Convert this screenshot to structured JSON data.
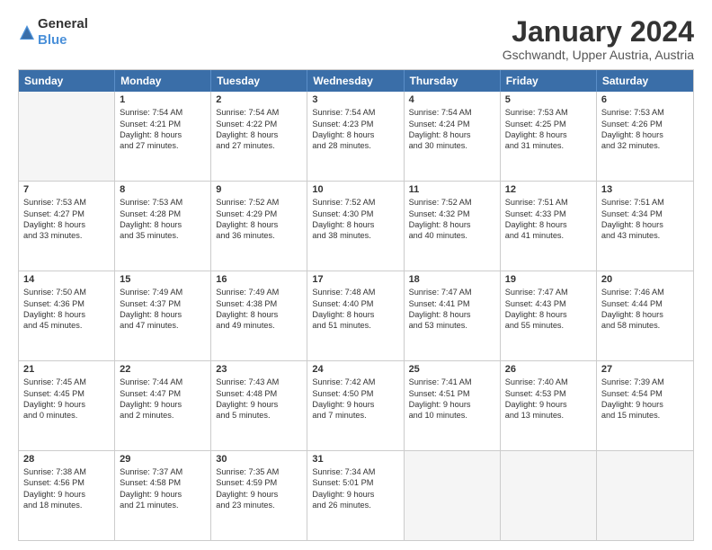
{
  "header": {
    "logo_general": "General",
    "logo_blue": "Blue",
    "title": "January 2024",
    "subtitle": "Gschwandt, Upper Austria, Austria"
  },
  "days": [
    "Sunday",
    "Monday",
    "Tuesday",
    "Wednesday",
    "Thursday",
    "Friday",
    "Saturday"
  ],
  "weeks": [
    [
      {
        "day": "",
        "sunrise": "",
        "sunset": "",
        "daylight": "",
        "empty": true
      },
      {
        "day": "1",
        "sunrise": "Sunrise: 7:54 AM",
        "sunset": "Sunset: 4:21 PM",
        "daylight": "Daylight: 8 hours and 27 minutes."
      },
      {
        "day": "2",
        "sunrise": "Sunrise: 7:54 AM",
        "sunset": "Sunset: 4:22 PM",
        "daylight": "Daylight: 8 hours and 27 minutes."
      },
      {
        "day": "3",
        "sunrise": "Sunrise: 7:54 AM",
        "sunset": "Sunset: 4:23 PM",
        "daylight": "Daylight: 8 hours and 28 minutes."
      },
      {
        "day": "4",
        "sunrise": "Sunrise: 7:54 AM",
        "sunset": "Sunset: 4:24 PM",
        "daylight": "Daylight: 8 hours and 30 minutes."
      },
      {
        "day": "5",
        "sunrise": "Sunrise: 7:53 AM",
        "sunset": "Sunset: 4:25 PM",
        "daylight": "Daylight: 8 hours and 31 minutes."
      },
      {
        "day": "6",
        "sunrise": "Sunrise: 7:53 AM",
        "sunset": "Sunset: 4:26 PM",
        "daylight": "Daylight: 8 hours and 32 minutes."
      }
    ],
    [
      {
        "day": "7",
        "sunrise": "Sunrise: 7:53 AM",
        "sunset": "Sunset: 4:27 PM",
        "daylight": "Daylight: 8 hours and 33 minutes."
      },
      {
        "day": "8",
        "sunrise": "Sunrise: 7:53 AM",
        "sunset": "Sunset: 4:28 PM",
        "daylight": "Daylight: 8 hours and 35 minutes."
      },
      {
        "day": "9",
        "sunrise": "Sunrise: 7:52 AM",
        "sunset": "Sunset: 4:29 PM",
        "daylight": "Daylight: 8 hours and 36 minutes."
      },
      {
        "day": "10",
        "sunrise": "Sunrise: 7:52 AM",
        "sunset": "Sunset: 4:30 PM",
        "daylight": "Daylight: 8 hours and 38 minutes."
      },
      {
        "day": "11",
        "sunrise": "Sunrise: 7:52 AM",
        "sunset": "Sunset: 4:32 PM",
        "daylight": "Daylight: 8 hours and 40 minutes."
      },
      {
        "day": "12",
        "sunrise": "Sunrise: 7:51 AM",
        "sunset": "Sunset: 4:33 PM",
        "daylight": "Daylight: 8 hours and 41 minutes."
      },
      {
        "day": "13",
        "sunrise": "Sunrise: 7:51 AM",
        "sunset": "Sunset: 4:34 PM",
        "daylight": "Daylight: 8 hours and 43 minutes."
      }
    ],
    [
      {
        "day": "14",
        "sunrise": "Sunrise: 7:50 AM",
        "sunset": "Sunset: 4:36 PM",
        "daylight": "Daylight: 8 hours and 45 minutes."
      },
      {
        "day": "15",
        "sunrise": "Sunrise: 7:49 AM",
        "sunset": "Sunset: 4:37 PM",
        "daylight": "Daylight: 8 hours and 47 minutes."
      },
      {
        "day": "16",
        "sunrise": "Sunrise: 7:49 AM",
        "sunset": "Sunset: 4:38 PM",
        "daylight": "Daylight: 8 hours and 49 minutes."
      },
      {
        "day": "17",
        "sunrise": "Sunrise: 7:48 AM",
        "sunset": "Sunset: 4:40 PM",
        "daylight": "Daylight: 8 hours and 51 minutes."
      },
      {
        "day": "18",
        "sunrise": "Sunrise: 7:47 AM",
        "sunset": "Sunset: 4:41 PM",
        "daylight": "Daylight: 8 hours and 53 minutes."
      },
      {
        "day": "19",
        "sunrise": "Sunrise: 7:47 AM",
        "sunset": "Sunset: 4:43 PM",
        "daylight": "Daylight: 8 hours and 55 minutes."
      },
      {
        "day": "20",
        "sunrise": "Sunrise: 7:46 AM",
        "sunset": "Sunset: 4:44 PM",
        "daylight": "Daylight: 8 hours and 58 minutes."
      }
    ],
    [
      {
        "day": "21",
        "sunrise": "Sunrise: 7:45 AM",
        "sunset": "Sunset: 4:45 PM",
        "daylight": "Daylight: 9 hours and 0 minutes."
      },
      {
        "day": "22",
        "sunrise": "Sunrise: 7:44 AM",
        "sunset": "Sunset: 4:47 PM",
        "daylight": "Daylight: 9 hours and 2 minutes."
      },
      {
        "day": "23",
        "sunrise": "Sunrise: 7:43 AM",
        "sunset": "Sunset: 4:48 PM",
        "daylight": "Daylight: 9 hours and 5 minutes."
      },
      {
        "day": "24",
        "sunrise": "Sunrise: 7:42 AM",
        "sunset": "Sunset: 4:50 PM",
        "daylight": "Daylight: 9 hours and 7 minutes."
      },
      {
        "day": "25",
        "sunrise": "Sunrise: 7:41 AM",
        "sunset": "Sunset: 4:51 PM",
        "daylight": "Daylight: 9 hours and 10 minutes."
      },
      {
        "day": "26",
        "sunrise": "Sunrise: 7:40 AM",
        "sunset": "Sunset: 4:53 PM",
        "daylight": "Daylight: 9 hours and 13 minutes."
      },
      {
        "day": "27",
        "sunrise": "Sunrise: 7:39 AM",
        "sunset": "Sunset: 4:54 PM",
        "daylight": "Daylight: 9 hours and 15 minutes."
      }
    ],
    [
      {
        "day": "28",
        "sunrise": "Sunrise: 7:38 AM",
        "sunset": "Sunset: 4:56 PM",
        "daylight": "Daylight: 9 hours and 18 minutes."
      },
      {
        "day": "29",
        "sunrise": "Sunrise: 7:37 AM",
        "sunset": "Sunset: 4:58 PM",
        "daylight": "Daylight: 9 hours and 21 minutes."
      },
      {
        "day": "30",
        "sunrise": "Sunrise: 7:35 AM",
        "sunset": "Sunset: 4:59 PM",
        "daylight": "Daylight: 9 hours and 23 minutes."
      },
      {
        "day": "31",
        "sunrise": "Sunrise: 7:34 AM",
        "sunset": "Sunset: 5:01 PM",
        "daylight": "Daylight: 9 hours and 26 minutes."
      },
      {
        "day": "",
        "sunrise": "",
        "sunset": "",
        "daylight": "",
        "empty": true
      },
      {
        "day": "",
        "sunrise": "",
        "sunset": "",
        "daylight": "",
        "empty": true
      },
      {
        "day": "",
        "sunrise": "",
        "sunset": "",
        "daylight": "",
        "empty": true
      }
    ]
  ]
}
